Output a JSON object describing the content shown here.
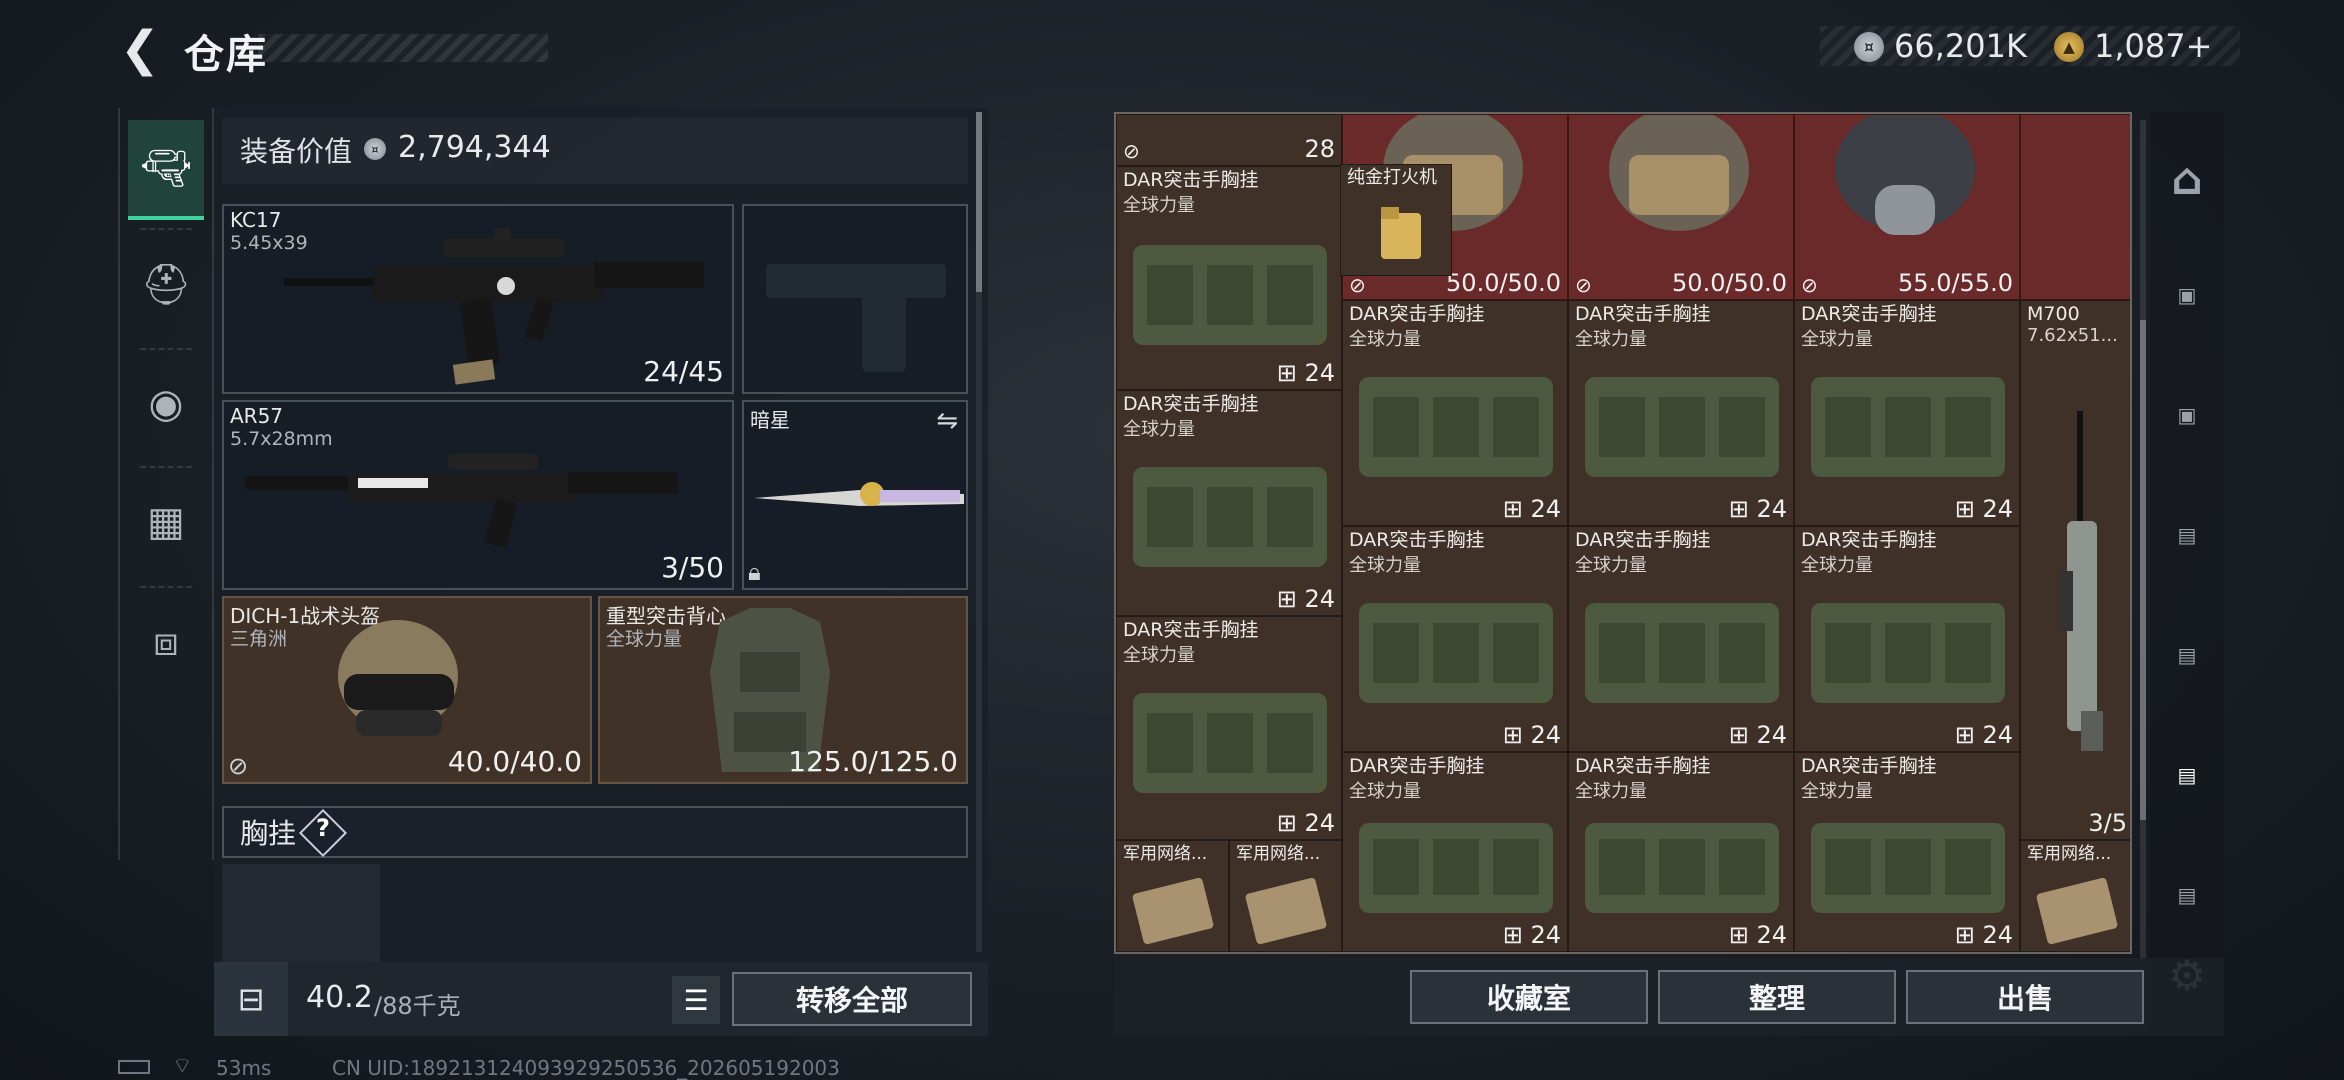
{
  "header": {
    "title": "仓库",
    "currency1": "66,201K",
    "currency2": "1,087+"
  },
  "left_rail": {
    "items": [
      {
        "icon": "pistol-icon",
        "active": true
      },
      {
        "icon": "backpack-icon"
      },
      {
        "icon": "bag-icon"
      },
      {
        "icon": "vest-icon"
      },
      {
        "icon": "toolbox-icon"
      }
    ]
  },
  "equipment": {
    "value_label": "装备价值",
    "value": "2,794,344",
    "primary": {
      "name": "KC17",
      "caliber": "5.45x39",
      "ammo": "24/45"
    },
    "secondary": {
      "name": "AR57",
      "caliber": "5.7x28mm",
      "ammo": "3/50"
    },
    "melee": {
      "name": "暗星"
    },
    "helmet": {
      "name": "DICH-1战术头盔",
      "origin": "三角洲",
      "durability": "40.0/40.0"
    },
    "armor": {
      "name": "重型突击背心",
      "origin": "全球力量",
      "durability": "125.0/125.0"
    },
    "chest_rig_label": "胸挂",
    "chest_rig_help": "?",
    "weight_value": "40.2",
    "weight_max": "/88千克",
    "transfer_all": "转移全部"
  },
  "storage": {
    "top_count": "28",
    "lighter": "纯金打火机",
    "helmet_1": "50.0/50.0",
    "helmet_2": "50.0/50.0",
    "helmet_3": "55.0/55.0",
    "dar_name": "DAR突击手胸挂",
    "dar_origin": "全球力量",
    "dar_count": "24",
    "rifle_name": "M700",
    "rifle_caliber": "7.62x51...",
    "rifle_ammo": "3/5",
    "ammo_box_name": "军用网络..."
  },
  "bottom_buttons": {
    "collection": "收藏室",
    "sort": "整理",
    "sell": "出售"
  },
  "status": {
    "ping": "53ms",
    "uid": "CN UID:189213124093929250536_202605192003"
  },
  "colors": {
    "accent": "#3fd49c",
    "storage_bg": "#3f3128",
    "red_slot": "#6a2a2a"
  }
}
